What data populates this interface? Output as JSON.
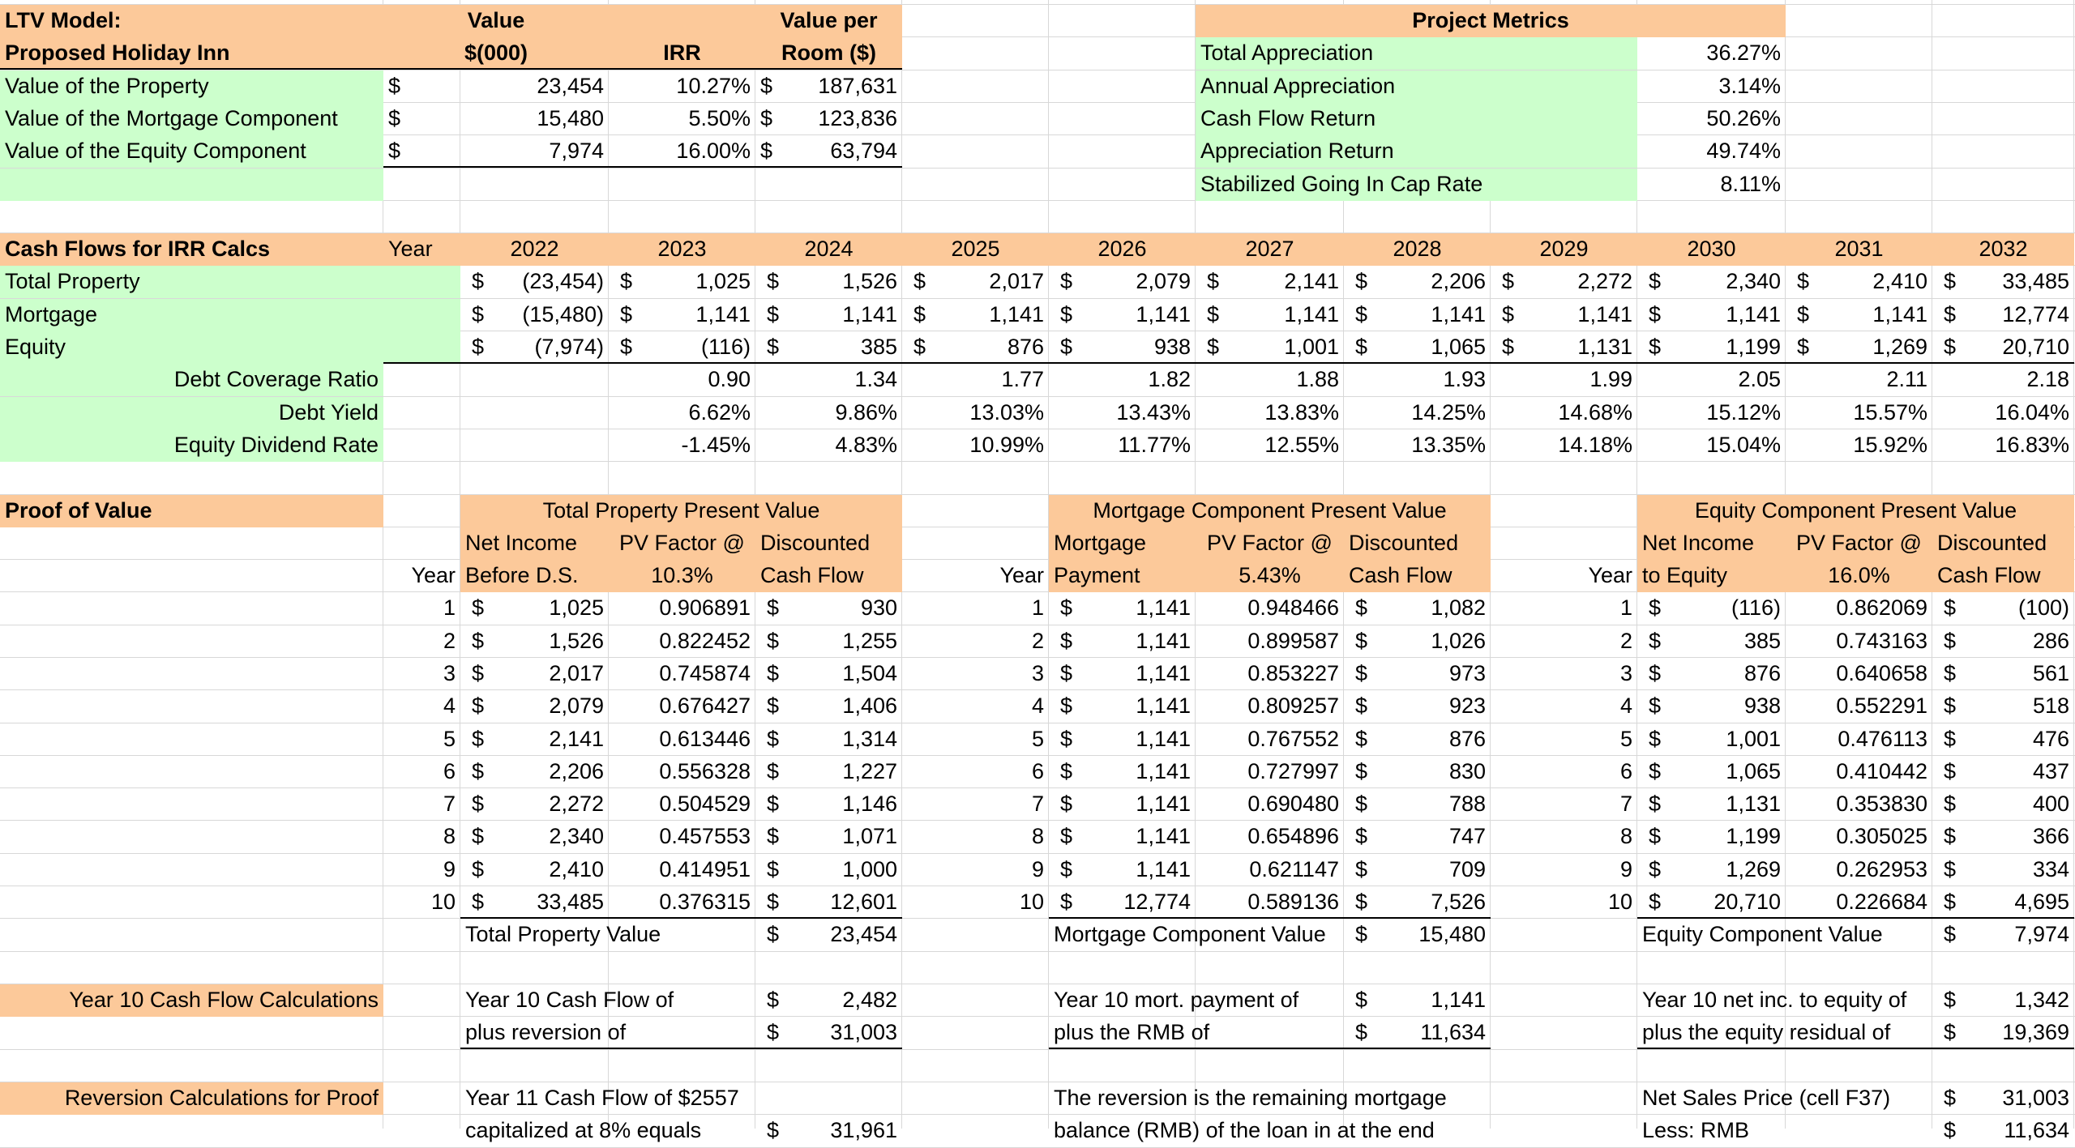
{
  "ltv": {
    "title1": "LTV Model:",
    "title2": "Proposed Holiday Inn",
    "h_value_1": "Value",
    "h_value_2": "$(000)",
    "h_irr": "IRR",
    "h_vpr_1": "Value per",
    "h_vpr_2": "Room ($)",
    "rows": [
      {
        "label": "Value of the Property",
        "cur": "$",
        "value": "23,454",
        "irr": "10.27%",
        "cur2": "$",
        "vpr": "187,631"
      },
      {
        "label": "Value of the Mortgage Component",
        "cur": "$",
        "value": "15,480",
        "irr": "5.50%",
        "cur2": "$",
        "vpr": "123,836"
      },
      {
        "label": "Value of the Equity Component",
        "cur": "$",
        "value": "7,974",
        "irr": "16.00%",
        "cur2": "$",
        "vpr": "63,794"
      }
    ]
  },
  "metrics": {
    "title": "Project Metrics",
    "rows": [
      {
        "label": "Total Appreciation",
        "value": "36.27%"
      },
      {
        "label": "Annual Appreciation",
        "value": "3.14%"
      },
      {
        "label": "Cash Flow Return",
        "value": "50.26%"
      },
      {
        "label": "Appreciation Return",
        "value": "49.74%"
      },
      {
        "label": "Stabilized Going In Cap Rate",
        "value": "8.11%"
      }
    ]
  },
  "cashflows": {
    "title": "Cash Flows for IRR Calcs",
    "year_label": "Year",
    "years": [
      "2022",
      "2023",
      "2024",
      "2025",
      "2026",
      "2027",
      "2028",
      "2029",
      "2030",
      "2031",
      "2032"
    ],
    "rows": [
      {
        "label": "Total Property",
        "values": [
          "(23,454)",
          "1,025",
          "1,526",
          "2,017",
          "2,079",
          "2,141",
          "2,206",
          "2,272",
          "2,340",
          "2,410",
          "33,485"
        ]
      },
      {
        "label": "Mortgage",
        "values": [
          "(15,480)",
          "1,141",
          "1,141",
          "1,141",
          "1,141",
          "1,141",
          "1,141",
          "1,141",
          "1,141",
          "1,141",
          "12,774"
        ]
      },
      {
        "label": "Equity",
        "values": [
          "(7,974)",
          "(116)",
          "385",
          "876",
          "938",
          "1,001",
          "1,065",
          "1,131",
          "1,199",
          "1,269",
          "20,710"
        ]
      }
    ],
    "ratios": [
      {
        "label": "Debt Coverage Ratio",
        "values": [
          "",
          "0.90",
          "1.34",
          "1.77",
          "1.82",
          "1.88",
          "1.93",
          "1.99",
          "2.05",
          "2.11",
          "2.18"
        ]
      },
      {
        "label": "Debt Yield",
        "values": [
          "",
          "6.62%",
          "9.86%",
          "13.03%",
          "13.43%",
          "13.83%",
          "14.25%",
          "14.68%",
          "15.12%",
          "15.57%",
          "16.04%"
        ]
      },
      {
        "label": "Equity Dividend Rate",
        "values": [
          "",
          "-1.45%",
          "4.83%",
          "10.99%",
          "11.77%",
          "12.55%",
          "13.35%",
          "14.18%",
          "15.04%",
          "15.92%",
          "16.83%"
        ]
      }
    ]
  },
  "proof": {
    "title": "Proof of Value",
    "year_label": "Year",
    "total": {
      "title": "Total Property Present Value",
      "h1a": "Net Income",
      "h1b": "Before D.S.",
      "h2a": "PV Factor @",
      "h2b": "10.3%",
      "h3a": "Discounted",
      "h3b": "Cash Flow",
      "rows": [
        {
          "n": "1",
          "a": "1,025",
          "f": "0.906891",
          "d": "930"
        },
        {
          "n": "2",
          "a": "1,526",
          "f": "0.822452",
          "d": "1,255"
        },
        {
          "n": "3",
          "a": "2,017",
          "f": "0.745874",
          "d": "1,504"
        },
        {
          "n": "4",
          "a": "2,079",
          "f": "0.676427",
          "d": "1,406"
        },
        {
          "n": "5",
          "a": "2,141",
          "f": "0.613446",
          "d": "1,314"
        },
        {
          "n": "6",
          "a": "2,206",
          "f": "0.556328",
          "d": "1,227"
        },
        {
          "n": "7",
          "a": "2,272",
          "f": "0.504529",
          "d": "1,146"
        },
        {
          "n": "8",
          "a": "2,340",
          "f": "0.457553",
          "d": "1,071"
        },
        {
          "n": "9",
          "a": "2,410",
          "f": "0.414951",
          "d": "1,000"
        },
        {
          "n": "10",
          "a": "33,485",
          "f": "0.376315",
          "d": "12,601"
        }
      ],
      "sum_label": "Total Property Value",
      "sum_value": "23,454"
    },
    "mortgage": {
      "title": "Mortgage Component Present Value",
      "h1a": "Mortgage",
      "h1b": "Payment",
      "h2a": "PV Factor @",
      "h2b": "5.43%",
      "h3a": "Discounted",
      "h3b": "Cash Flow",
      "rows": [
        {
          "n": "1",
          "a": "1,141",
          "f": "0.948466",
          "d": "1,082"
        },
        {
          "n": "2",
          "a": "1,141",
          "f": "0.899587",
          "d": "1,026"
        },
        {
          "n": "3",
          "a": "1,141",
          "f": "0.853227",
          "d": "973"
        },
        {
          "n": "4",
          "a": "1,141",
          "f": "0.809257",
          "d": "923"
        },
        {
          "n": "5",
          "a": "1,141",
          "f": "0.767552",
          "d": "876"
        },
        {
          "n": "6",
          "a": "1,141",
          "f": "0.727997",
          "d": "830"
        },
        {
          "n": "7",
          "a": "1,141",
          "f": "0.690480",
          "d": "788"
        },
        {
          "n": "8",
          "a": "1,141",
          "f": "0.654896",
          "d": "747"
        },
        {
          "n": "9",
          "a": "1,141",
          "f": "0.621147",
          "d": "709"
        },
        {
          "n": "10",
          "a": "12,774",
          "f": "0.589136",
          "d": "7,526"
        }
      ],
      "sum_label": "Mortgage Component Value",
      "sum_value": "15,480"
    },
    "equity": {
      "title": "Equity Component Present Value",
      "h1a": "Net Income",
      "h1b": "to Equity",
      "h2a": "PV Factor @",
      "h2b": "16.0%",
      "h3a": "Discounted",
      "h3b": "Cash Flow",
      "rows": [
        {
          "n": "1",
          "a": "(116)",
          "f": "0.862069",
          "d": "(100)"
        },
        {
          "n": "2",
          "a": "385",
          "f": "0.743163",
          "d": "286"
        },
        {
          "n": "3",
          "a": "876",
          "f": "0.640658",
          "d": "561"
        },
        {
          "n": "4",
          "a": "938",
          "f": "0.552291",
          "d": "518"
        },
        {
          "n": "5",
          "a": "1,001",
          "f": "0.476113",
          "d": "476"
        },
        {
          "n": "6",
          "a": "1,065",
          "f": "0.410442",
          "d": "437"
        },
        {
          "n": "7",
          "a": "1,131",
          "f": "0.353830",
          "d": "400"
        },
        {
          "n": "8",
          "a": "1,199",
          "f": "0.305025",
          "d": "366"
        },
        {
          "n": "9",
          "a": "1,269",
          "f": "0.262953",
          "d": "334"
        },
        {
          "n": "10",
          "a": "20,710",
          "f": "0.226684",
          "d": "4,695"
        }
      ],
      "sum_label": "Equity Component Value",
      "sum_value": "7,974"
    }
  },
  "year10": {
    "label": "Year 10 Cash Flow Calculations",
    "total": {
      "l1": "Year 10 Cash Flow of",
      "v1": "2,482",
      "l2": "plus reversion of",
      "v2": "31,003"
    },
    "mortgage": {
      "l1": "Year 10 mort. payment of",
      "v1": "1,141",
      "l2": "plus the RMB of",
      "v2": "11,634"
    },
    "equity": {
      "l1": "Year 10 net inc. to equity of",
      "v1": "1,342",
      "l2": "plus the equity residual of",
      "v2": "19,369"
    }
  },
  "reversion": {
    "label": "Reversion Calculations for Proof",
    "total": {
      "l1": "Year 11 Cash Flow of $2557",
      "l2": "capitalized at 8% equals",
      "v2": "31,961"
    },
    "mortgage": {
      "l1": "The reversion is the remaining mortgage",
      "l2": "balance (RMB) of the loan in at the end"
    },
    "equity": {
      "l1": "Net Sales Price (cell F37)",
      "v1": "31,003",
      "l2": "Less: RMB",
      "v2": "11,634"
    }
  },
  "currency_symbol": "$",
  "colors": {
    "header_orange": "#fcc99a",
    "label_green": "#ccffcc",
    "grid": "#d8d8d8"
  }
}
